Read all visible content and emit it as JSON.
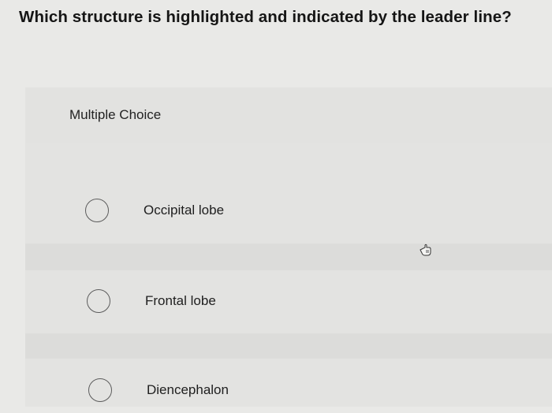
{
  "question": {
    "text": "Which structure is highlighted and indicated by the leader line?"
  },
  "section": {
    "label": "Multiple Choice"
  },
  "options": [
    {
      "label": "Occipital lobe",
      "selected": false
    },
    {
      "label": "Frontal lobe",
      "selected": false
    },
    {
      "label": "Diencephalon",
      "selected": false
    }
  ],
  "cursor": {
    "icon": "hand-pointer-icon"
  }
}
